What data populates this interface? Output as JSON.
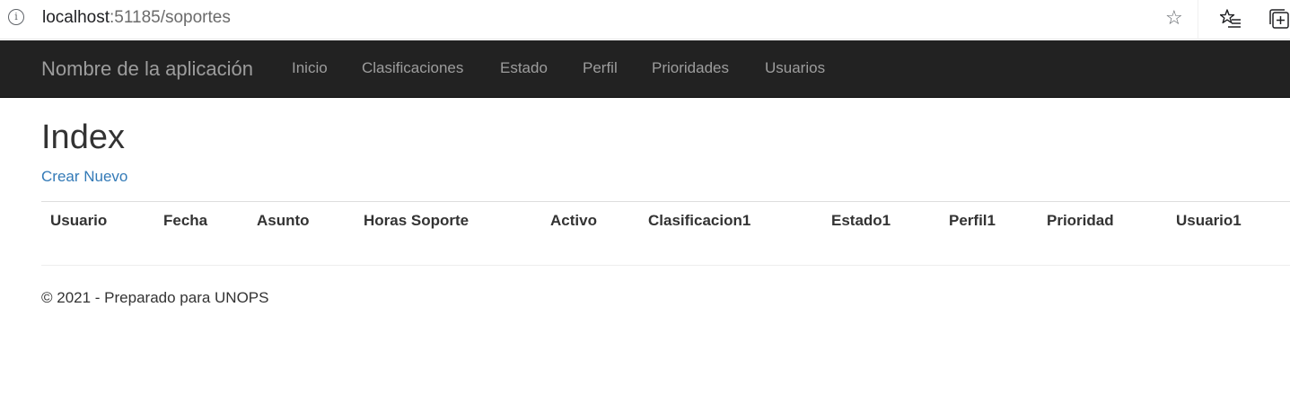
{
  "browser": {
    "url_host": "localhost",
    "url_path": ":51185/soportes",
    "info_icon": "info-icon",
    "favorite_icon": "star-icon",
    "favorites_list_icon": "favorites-list-icon",
    "collections_icon": "collections-icon"
  },
  "navbar": {
    "brand": "Nombre de la aplicación",
    "links": [
      "Inicio",
      "Clasificaciones",
      "Estado",
      "Perfil",
      "Prioridades",
      "Usuarios"
    ]
  },
  "main": {
    "title": "Index",
    "create_link": "Crear Nuevo",
    "table": {
      "columns": [
        "Usuario",
        "Fecha",
        "Asunto",
        "Horas Soporte",
        "Activo",
        "Clasificacion1",
        "Estado1",
        "Perfil1",
        "Prioridad",
        "Usuario1"
      ],
      "rows": []
    }
  },
  "footer": {
    "text": "© 2021 - Preparado para UNOPS"
  },
  "colors": {
    "navbar_bg": "#222222",
    "navbar_text": "#9d9d9d",
    "link": "#337ab7",
    "text": "#333333"
  }
}
